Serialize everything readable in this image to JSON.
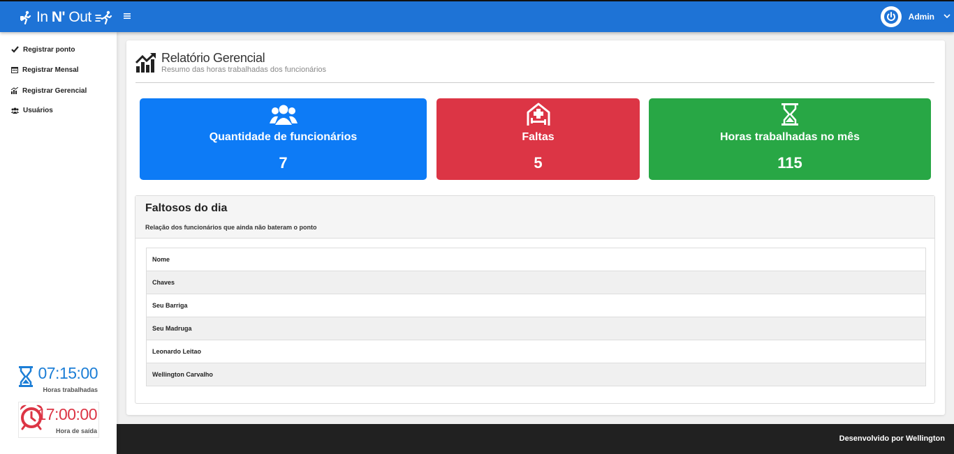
{
  "header": {
    "brand_prefix": "In ",
    "brand_bold": "N'",
    "brand_suffix": " Out",
    "user_name": "Admin",
    "colors": {
      "topbar": "#1e73d6"
    }
  },
  "sidebar": {
    "items": [
      {
        "label": "Registrar ponto",
        "icon": "check-icon"
      },
      {
        "label": "Registrar Mensal",
        "icon": "calendar-icon"
      },
      {
        "label": "Registrar Gerencial",
        "icon": "chart-icon"
      },
      {
        "label": "Usuários",
        "icon": "users-icon"
      }
    ],
    "worked": {
      "time": "07:15:00",
      "label": "Horas trabalhadas",
      "icon": "hourglass-icon"
    },
    "exit": {
      "time": "17:00:00",
      "label": "Hora de saída",
      "icon": "alarm-clock-icon"
    }
  },
  "page": {
    "title": "Relatório Gerencial",
    "subtitle": "Resumo das horas trabalhadas dos funcionários"
  },
  "stats": [
    {
      "label": "Quantidade de funcionários",
      "value": "7",
      "icon": "users-icon",
      "color": "#0d7bf6"
    },
    {
      "label": "Faltas",
      "value": "5",
      "icon": "hospital-bed-icon",
      "color": "#dc3545"
    },
    {
      "label": "Horas trabalhadas no mês",
      "value": "115",
      "icon": "hourglass-icon",
      "color": "#28a745"
    }
  ],
  "absent": {
    "title": "Faltosos do dia",
    "description": "Relação dos funcionários que ainda não bateram o ponto",
    "column": "Nome",
    "rows": [
      "Chaves",
      "Seu Barriga",
      "Seu Madruga",
      "Leonardo Leitao",
      "Wellington Carvalho"
    ]
  },
  "footer": {
    "text": "Desenvolvido por Wellington"
  }
}
